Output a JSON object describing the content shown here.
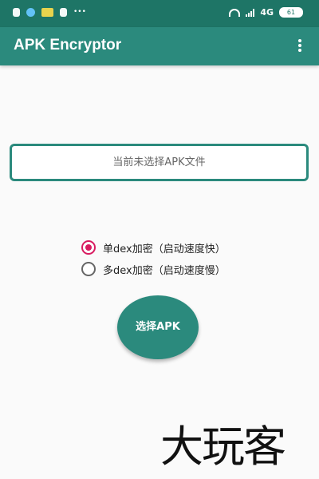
{
  "status_bar": {
    "left_icons": [
      "security-icon",
      "app-icon",
      "calendar-icon",
      "sd-card-icon",
      "more-dots-icon"
    ],
    "more_dots": "•••",
    "network": "4G",
    "battery": "61",
    "right_icons": [
      "wifi-icon",
      "signal-icon",
      "battery-icon"
    ]
  },
  "app_bar": {
    "title": "APK Encryptor",
    "menu_icon": "more-vertical-icon"
  },
  "file": {
    "status_text": "当前未选择APK文件"
  },
  "options": [
    {
      "label": "单dex加密（启动速度快）",
      "checked": true
    },
    {
      "label": "多dex加密（启动速度慢）",
      "checked": false
    }
  ],
  "actions": {
    "select_apk_label": "选择APK"
  },
  "watermark": {
    "text": "大玩客"
  },
  "colors": {
    "status_bar": "#1e7566",
    "app_bar": "#2b8a7d",
    "accent": "#2b8a7d",
    "radio_selected": "#d81b60",
    "background": "#fafafa"
  }
}
